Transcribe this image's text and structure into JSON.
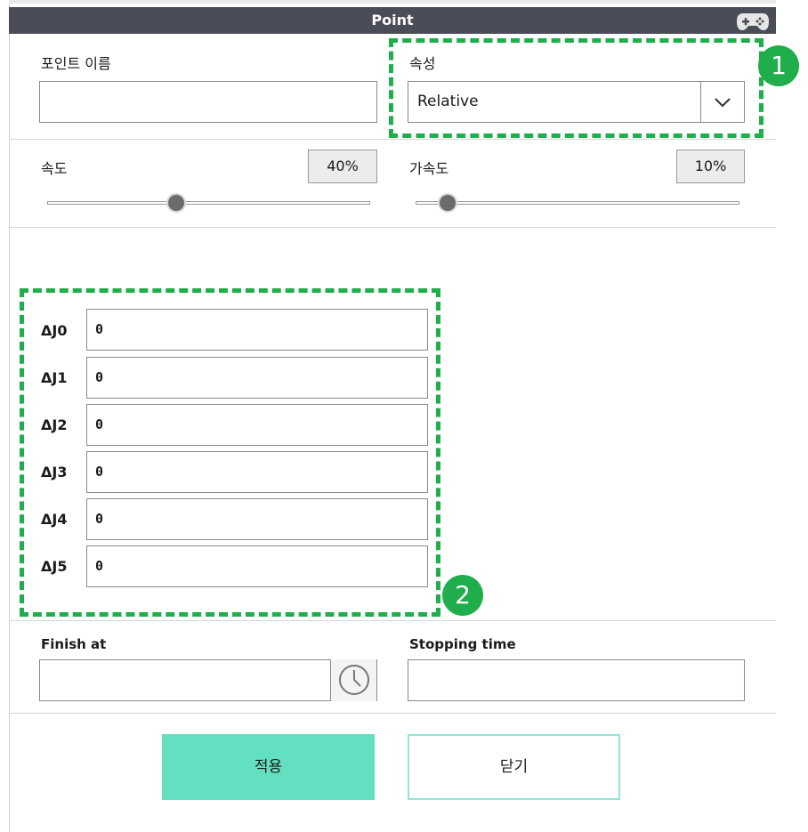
{
  "dialog": {
    "title": "Point"
  },
  "form": {
    "point_name_label": "포인트 이름",
    "point_name_value": "",
    "property_label": "속성",
    "property_value": "Relative"
  },
  "speed": {
    "label": "속도",
    "value_text": "40%",
    "level_percent": 40
  },
  "acceleration": {
    "label": "가속도",
    "value_text": "10%",
    "level_percent": 10
  },
  "joints": [
    {
      "label": "ΔJ0",
      "value": "0"
    },
    {
      "label": "ΔJ1",
      "value": "0"
    },
    {
      "label": "ΔJ2",
      "value": "0"
    },
    {
      "label": "ΔJ3",
      "value": "0"
    },
    {
      "label": "ΔJ4",
      "value": "0"
    },
    {
      "label": "ΔJ5",
      "value": "0"
    }
  ],
  "finish": {
    "label": "Finish at",
    "value": ""
  },
  "stopping": {
    "label": "Stopping time",
    "value": ""
  },
  "buttons": {
    "apply": "적용",
    "close": "닫기"
  },
  "annotations": {
    "badge1": "1",
    "badge2": "2",
    "color": "#1fae4b"
  },
  "icons": {
    "gamepad": "gamepad-icon",
    "dropdown": "chevron-down-icon",
    "clock": "clock-icon"
  },
  "colors": {
    "titlebar": "#4a4c57",
    "apply_button": "#63e0c1",
    "close_button_border": "#8fe6d2"
  }
}
